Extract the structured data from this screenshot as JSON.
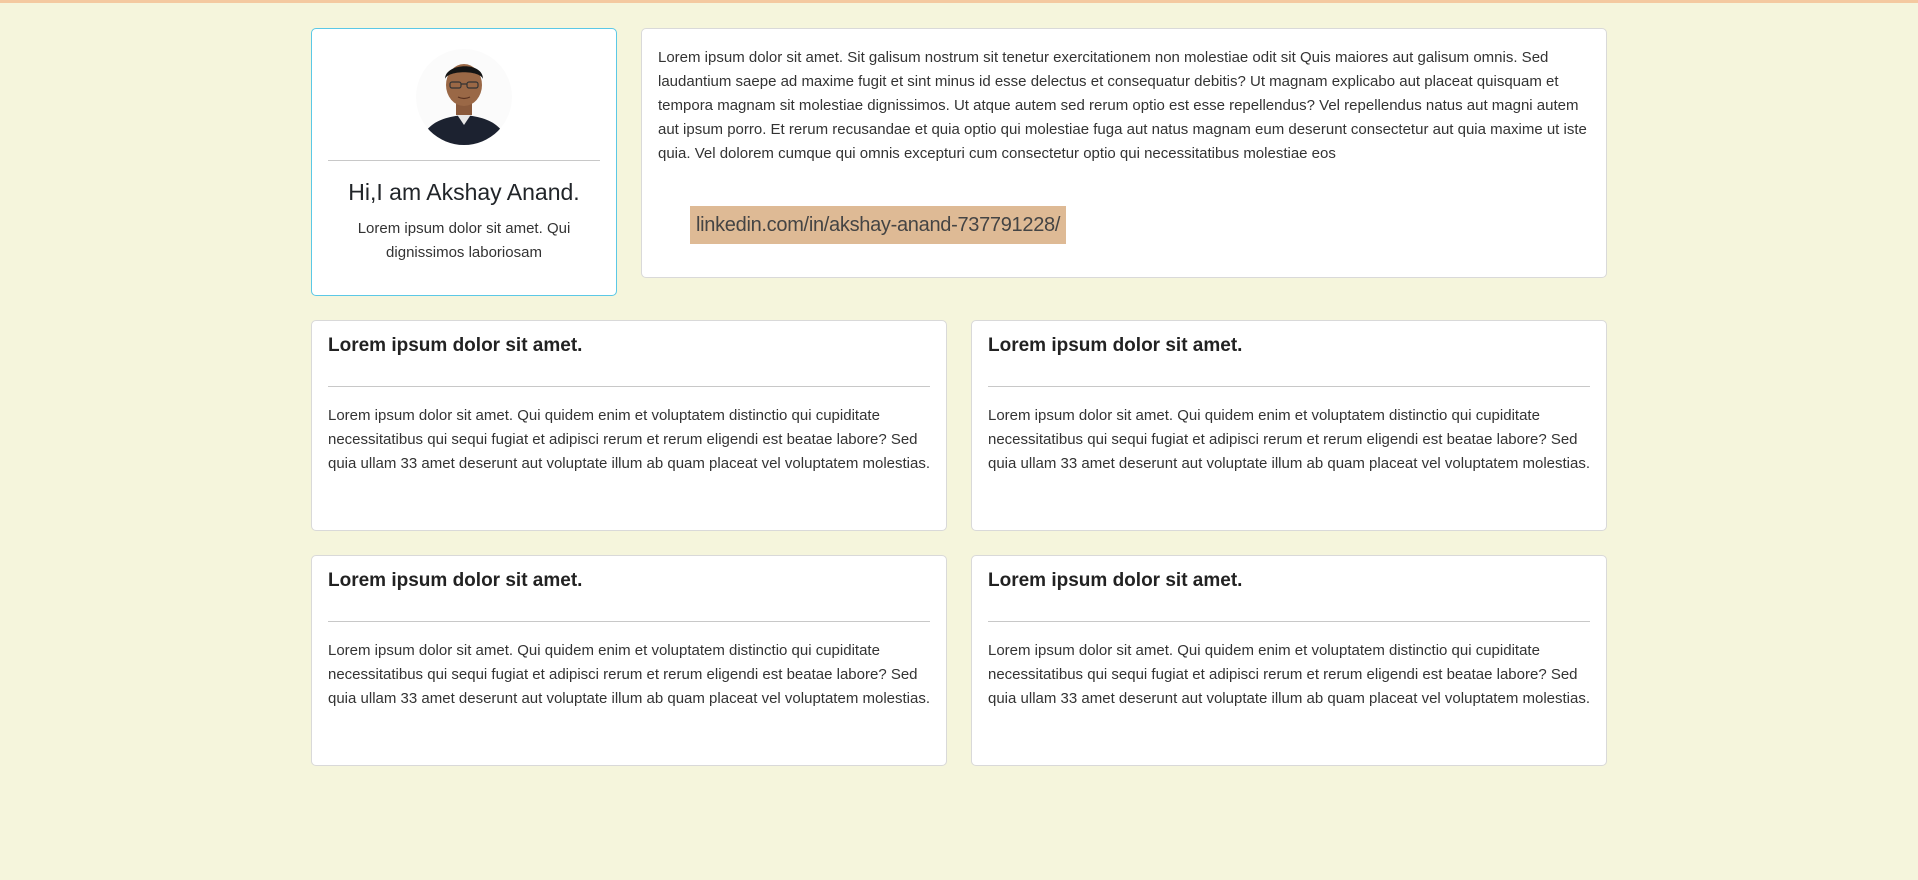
{
  "profile": {
    "name": "Hi,I am Akshay Anand.",
    "tagline": "Lorem ipsum dolor sit amet. Qui dignissimos laboriosam",
    "avatar_icon": "person-avatar-icon"
  },
  "intro": {
    "text": "Lorem ipsum dolor sit amet. Sit galisum nostrum sit tenetur exercitationem non molestiae odit sit Quis maiores aut galisum omnis. Sed laudantium saepe ad maxime fugit et sint minus id esse delectus et consequatur debitis? Ut magnam explicabo aut placeat quisquam et tempora magnam sit molestiae dignissimos. Ut atque autem sed rerum optio est esse repellendus? Vel repellendus natus aut magni autem aut ipsum porro. Et rerum recusandae et quia optio qui molestiae fuga aut natus magnam eum deserunt consectetur aut quia maxime ut iste quia. Vel dolorem cumque qui omnis excepturi cum consectetur optio qui necessitatibus molestiae eos",
    "link_text": "linkedin.com/in/akshay-anand-737791228/"
  },
  "cards": [
    {
      "title": "Lorem ipsum dolor sit amet.",
      "body": "Lorem ipsum dolor sit amet. Qui quidem enim et voluptatem distinctio qui cupiditate necessitatibus qui sequi fugiat et adipisci rerum et rerum eligendi est beatae labore? Sed quia ullam 33 amet deserunt aut voluptate illum ab quam placeat vel voluptatem molestias."
    },
    {
      "title": "Lorem ipsum dolor sit amet.",
      "body": "Lorem ipsum dolor sit amet. Qui quidem enim et voluptatem distinctio qui cupiditate necessitatibus qui sequi fugiat et adipisci rerum et rerum eligendi est beatae labore? Sed quia ullam 33 amet deserunt aut voluptate illum ab quam placeat vel voluptatem molestias."
    },
    {
      "title": "Lorem ipsum dolor sit amet.",
      "body": "Lorem ipsum dolor sit amet. Qui quidem enim et voluptatem distinctio qui cupiditate necessitatibus qui sequi fugiat et adipisci rerum et rerum eligendi est beatae labore? Sed quia ullam 33 amet deserunt aut voluptate illum ab quam placeat vel voluptatem molestias."
    },
    {
      "title": "Lorem ipsum dolor sit amet.",
      "body": "Lorem ipsum dolor sit amet. Qui quidem enim et voluptatem distinctio qui cupiditate necessitatibus qui sequi fugiat et adipisci rerum et rerum eligendi est beatae labore? Sed quia ullam 33 amet deserunt aut voluptate illum ab quam placeat vel voluptatem molestias."
    }
  ],
  "colors": {
    "page_background": "#f5f5dc",
    "profile_border": "#5bc8e6",
    "link_highlight": "#deba95",
    "top_strip": "#f4c9a0"
  }
}
